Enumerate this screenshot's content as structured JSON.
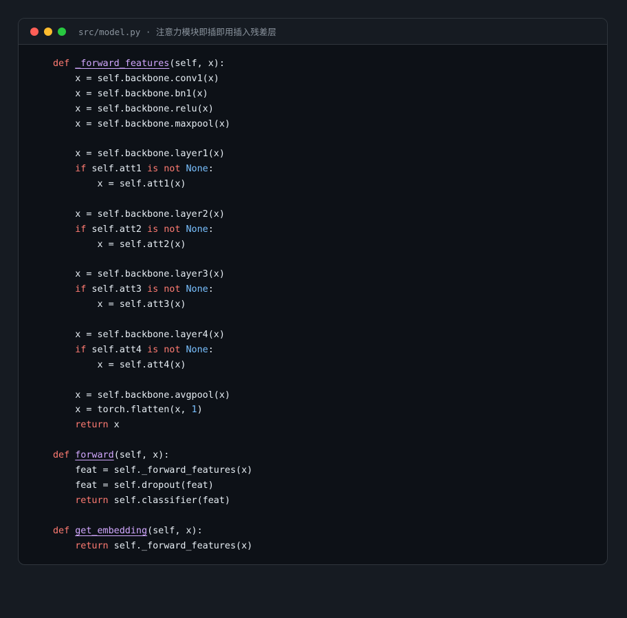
{
  "window": {
    "title": "src/model.py · 注意力模块即插即用插入残差层",
    "controls": [
      "close",
      "minimize",
      "maximize"
    ]
  },
  "code": {
    "language": "python",
    "lines": [
      [
        {
          "t": "def",
          "c": "kw"
        },
        {
          "t": " "
        },
        {
          "t": "_forward_features",
          "c": "fn"
        },
        {
          "t": "(self, x):"
        }
      ],
      [
        {
          "t": "    x = self.backbone.conv1(x)"
        }
      ],
      [
        {
          "t": "    x = self.backbone.bn1(x)"
        }
      ],
      [
        {
          "t": "    x = self.backbone.relu(x)"
        }
      ],
      [
        {
          "t": "    x = self.backbone.maxpool(x)"
        }
      ],
      [],
      [
        {
          "t": "    x = self.backbone.layer1(x)"
        }
      ],
      [
        {
          "t": "    "
        },
        {
          "t": "if",
          "c": "kw"
        },
        {
          "t": " self.att1 "
        },
        {
          "t": "is not",
          "c": "kw"
        },
        {
          "t": " "
        },
        {
          "t": "None",
          "c": "const"
        },
        {
          "t": ":"
        }
      ],
      [
        {
          "t": "        x = self.att1(x)"
        }
      ],
      [],
      [
        {
          "t": "    x = self.backbone.layer2(x)"
        }
      ],
      [
        {
          "t": "    "
        },
        {
          "t": "if",
          "c": "kw"
        },
        {
          "t": " self.att2 "
        },
        {
          "t": "is not",
          "c": "kw"
        },
        {
          "t": " "
        },
        {
          "t": "None",
          "c": "const"
        },
        {
          "t": ":"
        }
      ],
      [
        {
          "t": "        x = self.att2(x)"
        }
      ],
      [],
      [
        {
          "t": "    x = self.backbone.layer3(x)"
        }
      ],
      [
        {
          "t": "    "
        },
        {
          "t": "if",
          "c": "kw"
        },
        {
          "t": " self.att3 "
        },
        {
          "t": "is not",
          "c": "kw"
        },
        {
          "t": " "
        },
        {
          "t": "None",
          "c": "const"
        },
        {
          "t": ":"
        }
      ],
      [
        {
          "t": "        x = self.att3(x)"
        }
      ],
      [],
      [
        {
          "t": "    x = self.backbone.layer4(x)"
        }
      ],
      [
        {
          "t": "    "
        },
        {
          "t": "if",
          "c": "kw"
        },
        {
          "t": " self.att4 "
        },
        {
          "t": "is not",
          "c": "kw"
        },
        {
          "t": " "
        },
        {
          "t": "None",
          "c": "const"
        },
        {
          "t": ":"
        }
      ],
      [
        {
          "t": "        x = self.att4(x)"
        }
      ],
      [],
      [
        {
          "t": "    x = self.backbone.avgpool(x)"
        }
      ],
      [
        {
          "t": "    x = torch.flatten(x, "
        },
        {
          "t": "1",
          "c": "num"
        },
        {
          "t": ")"
        }
      ],
      [
        {
          "t": "    "
        },
        {
          "t": "return",
          "c": "kw"
        },
        {
          "t": " x"
        }
      ],
      [],
      [
        {
          "t": "def",
          "c": "kw"
        },
        {
          "t": " "
        },
        {
          "t": "forward",
          "c": "fn"
        },
        {
          "t": "(self, x):"
        }
      ],
      [
        {
          "t": "    feat = self._forward_features(x)"
        }
      ],
      [
        {
          "t": "    feat = self.dropout(feat)"
        }
      ],
      [
        {
          "t": "    "
        },
        {
          "t": "return",
          "c": "kw"
        },
        {
          "t": " self.classifier(feat)"
        }
      ],
      [],
      [
        {
          "t": "def",
          "c": "kw"
        },
        {
          "t": " "
        },
        {
          "t": "get_embedding",
          "c": "fn"
        },
        {
          "t": "(self, x):"
        }
      ],
      [
        {
          "t": "    "
        },
        {
          "t": "return",
          "c": "kw"
        },
        {
          "t": " self._forward_features(x)"
        }
      ]
    ]
  },
  "colors": {
    "page_bg": "#161b22",
    "editor_bg": "#0d1117",
    "keyword": "#ff7b72",
    "function_name": "#d2a8ff",
    "constant": "#79c0ff",
    "text": "#e6edf3"
  }
}
